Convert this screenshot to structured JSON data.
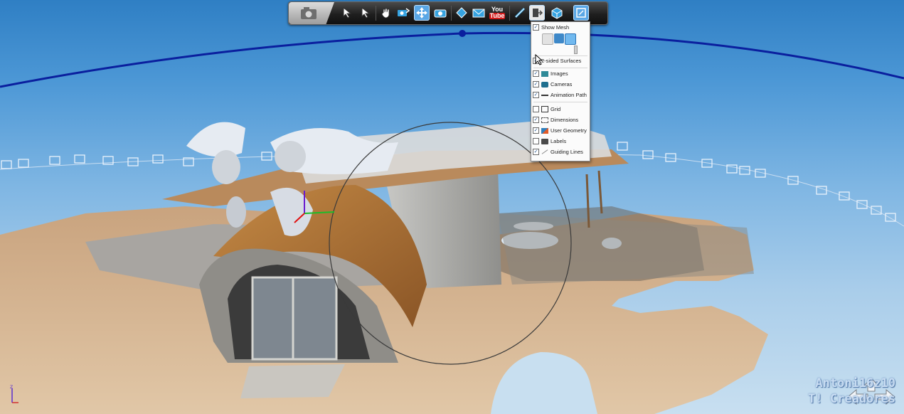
{
  "menu": {
    "show_mesh": "Show Mesh",
    "two_sided": "2-sided Surfaces",
    "images": "Images",
    "cameras": "Cameras",
    "animation_path": "Animation Path",
    "grid": "Grid",
    "dimensions": "Dimensions",
    "user_geometry": "User Geometry",
    "labels": "Labels",
    "guiding_lines": "Guiding Lines"
  },
  "checks": {
    "show_mesh": true,
    "two_sided": true,
    "images": true,
    "cameras": true,
    "animation_path": true,
    "grid": false,
    "dimensions": true,
    "user_geometry": true,
    "labels": false,
    "guiding_lines": true
  },
  "toolbar": {
    "youtube_top": "You",
    "youtube_bottom": "Tube",
    "icons": [
      "snapshot-camera-icon",
      "select-arrow-icon",
      "select-add-arrow-icon",
      "pan-hand-icon",
      "orbit-camera-icon",
      "navigate-icon",
      "camera-icon",
      "tag-icon",
      "email-icon",
      "youtube-icon",
      "measure-icon",
      "export-icon",
      "view-cube-icon",
      "display-options-icon"
    ]
  },
  "watermark": {
    "line1": "Antoni16z10",
    "line2": "T! Creadores"
  },
  "colors": {
    "sky_top": "#2f7fc4",
    "sand": "#d9b892",
    "path_blue": "#0a1f9e",
    "toolbar_bg": "#1f1f1f",
    "active_button": "#5aa7e6"
  }
}
